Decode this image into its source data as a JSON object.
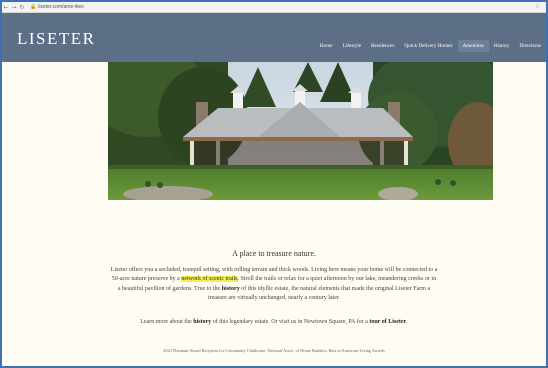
{
  "browser": {
    "url": "liseter.com/ame-ities",
    "back_icon": "arrow-left-icon",
    "forward_icon": "arrow-right-icon",
    "reload_icon": "reload-icon",
    "lock_icon": "lock-icon",
    "bookmark_icon": "star-icon"
  },
  "site": {
    "logo": "LISETER",
    "header_color": "#5c6f86"
  },
  "nav": {
    "items": [
      {
        "label": "Home"
      },
      {
        "label": "Lifestyle"
      },
      {
        "label": "Residences"
      },
      {
        "label": "Quick Delivery Homes"
      },
      {
        "label": "Amenities"
      },
      {
        "label": "History"
      },
      {
        "label": "Directions"
      }
    ],
    "active": "Amenities"
  },
  "content": {
    "tagline": "A place to treasure nature.",
    "p1": "Liseter offers you a secluded, tranquil setting, with rolling terrain and thick woods. Living here means your home will be connected to a 50-acre nature preserve by a ",
    "p1_highlight": "network of scenic trails",
    "p1_rest": ". Stroll the trails or relax for a quiet afternoon by our lake, meandering creeks or in a beautiful pavilion of gardens. True to the ",
    "p1_history": "history",
    "p1_end": " of this idyllic estate, the natural elements that made the original Liseter Farm a treasure are virtually unchanged, nearly a century later.",
    "learn_1": "Learn more about the ",
    "learn_history": "history",
    "learn_2": " of this legendary estate. Or visit us in Newtown Square, PA for a ",
    "learn_tour": "tour of Liseter",
    "learn_3": ".",
    "awards": "2023 Platinum Award Recipient for Community Clubhouse, National Assoc. of Home Builders, Best in American Living Awards"
  },
  "colors": {
    "highlight": "#f4ee52",
    "frame_border": "#3f6fb5",
    "background": "#fffdf3"
  }
}
